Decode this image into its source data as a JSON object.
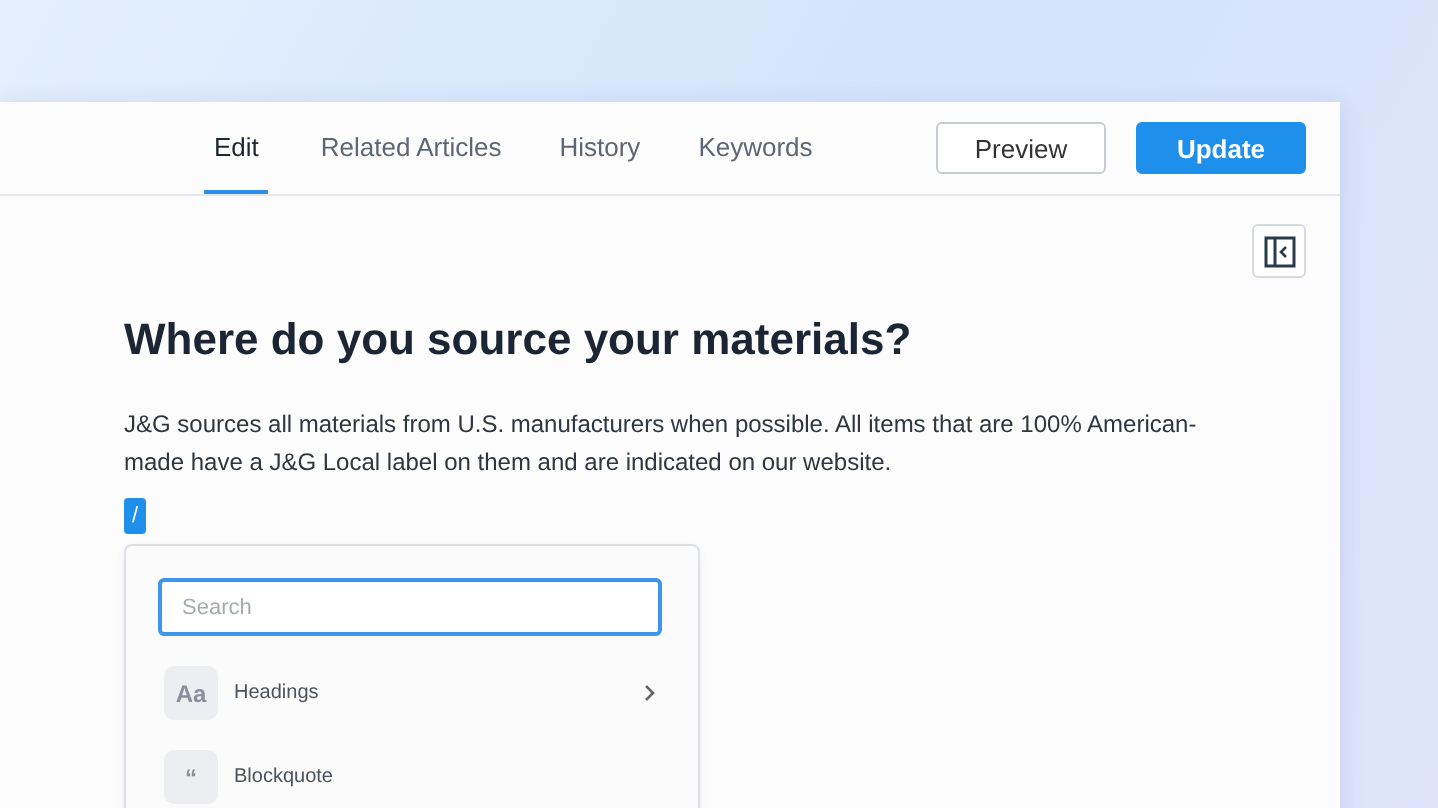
{
  "tabs": [
    {
      "label": "Edit",
      "selected": true
    },
    {
      "label": "Related Articles",
      "selected": false
    },
    {
      "label": "History",
      "selected": false
    },
    {
      "label": "Keywords",
      "selected": false
    }
  ],
  "buttons": [
    {
      "label": "Preview",
      "kind": "secondary"
    },
    {
      "label": "Update",
      "kind": "primary"
    }
  ],
  "article": {
    "title": "Where do you source your materials?",
    "body": "J&G sources all materials from U.S. manufacturers when possible. All items that are 100% American-made have a J&G Local label on them and are indicated on our website."
  },
  "slash_trigger": "/",
  "insert_menu": {
    "search": {
      "placeholder": "Search"
    },
    "items": [
      {
        "icon_text": "Aa",
        "label": "Headings",
        "has_submenu": true
      },
      {
        "icon_text": "“",
        "label": "Blockquote",
        "has_submenu": false
      }
    ]
  }
}
